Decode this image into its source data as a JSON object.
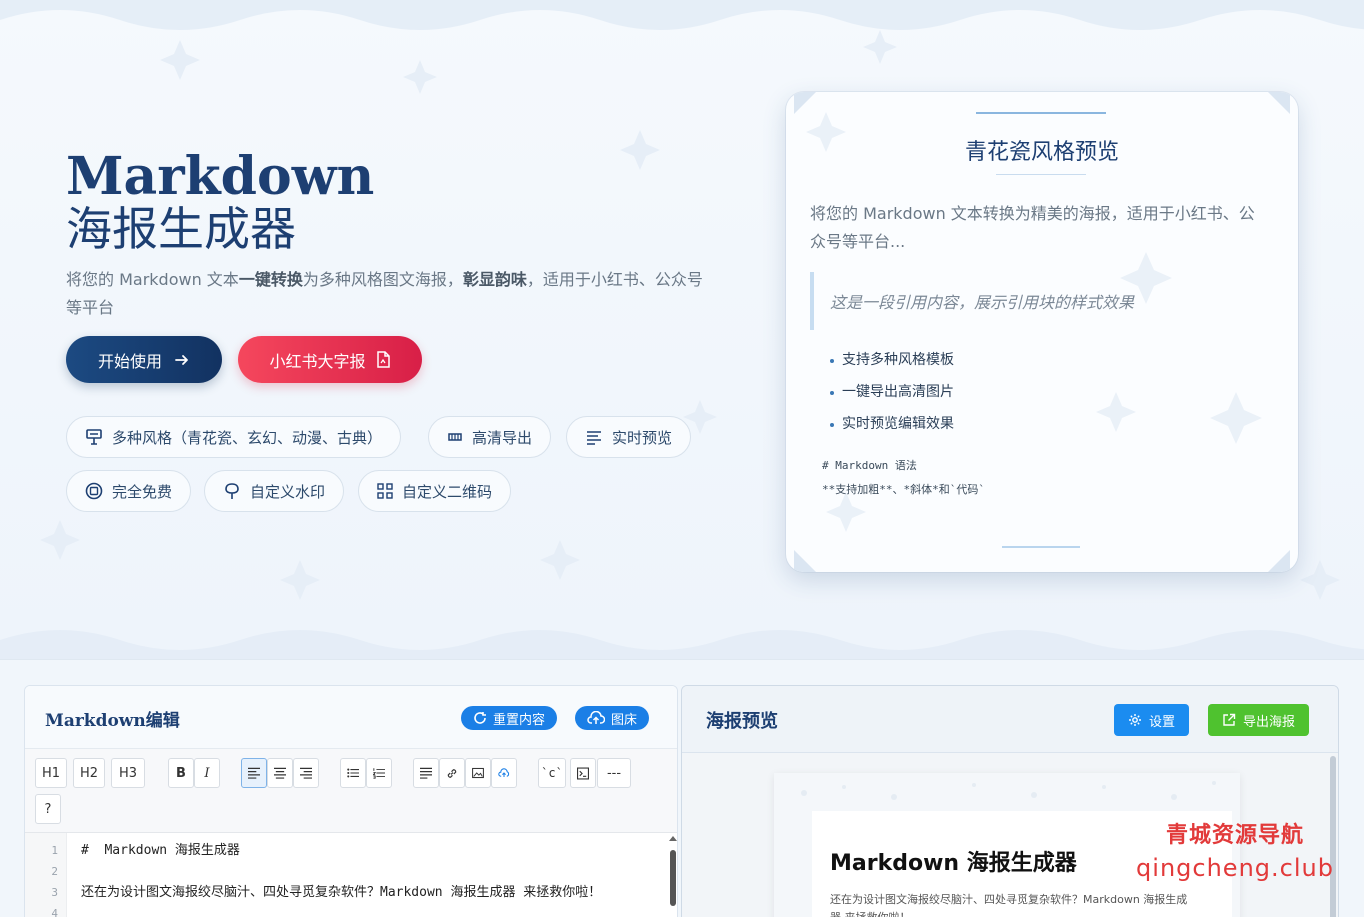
{
  "hero": {
    "title_line1": "Markdown",
    "title_line2": "海报生成器",
    "desc_part1": "将您的 Markdown 文本",
    "desc_bold1": "一键转换",
    "desc_part2": "为多种风格图文海报，",
    "desc_bold2": "彰显韵味",
    "desc_part3": "，适用于小红书、公众号等平台",
    "btn_start": "开始使用",
    "btn_xhs": "小红书大字报",
    "features": [
      {
        "label": "多种风格（青花瓷、玄幻、动漫、古典）",
        "icon": "palette-icon"
      },
      {
        "label": "高清导出",
        "icon": "hd-icon"
      },
      {
        "label": "实时预览",
        "icon": "lines-icon"
      },
      {
        "label": "完全免费",
        "icon": "free-icon"
      },
      {
        "label": "自定义水印",
        "icon": "stamp-icon"
      },
      {
        "label": "自定义二维码",
        "icon": "qrcode-icon"
      }
    ]
  },
  "preview_card": {
    "title": "青花瓷风格预览",
    "desc": "将您的 Markdown 文本转换为精美的海报，适用于小红书、公众号等平台...",
    "quote": "这是一段引用内容，展示引用块的样式效果",
    "list": [
      "支持多种风格模板",
      "一键导出高清图片",
      "实时预览编辑效果"
    ],
    "code_line1": "# Markdown 语法",
    "code_line2": "**支持加粗**、*斜体*和`代码`"
  },
  "editor": {
    "title": "Markdown编辑",
    "btn_reset": "重置内容",
    "btn_image_host": "图床",
    "toolbar": [
      "H1",
      "H2",
      "H3",
      "B",
      "I",
      "≡",
      "≡",
      "≡",
      "☰",
      "☰",
      "≡",
      "🔗",
      "▣",
      "☁",
      "`c`",
      "⊡",
      "---",
      "?"
    ],
    "line_numbers": [
      "1",
      "2",
      "3",
      "4"
    ],
    "lines": [
      "#  Markdown 海报生成器",
      "",
      "还在为设计图文海报绞尽脑汁、四处寻觅复杂软件？Markdown 海报生成器 来拯救你啦！",
      ""
    ]
  },
  "preview_panel": {
    "title": "海报预览",
    "btn_settings": "设置",
    "btn_export": "导出海报",
    "poster_title": "Markdown 海报生成器",
    "poster_text": "还在为设计图文海报绞尽脑汁、四处寻觅复杂软件？Markdown 海报生成器 来拯救你啦！"
  },
  "watermark": {
    "line1": "青城资源导航",
    "line2": "qingcheng.club"
  },
  "colors": {
    "brand_blue": "#1d3f72",
    "accent_blue": "#1b7fe6",
    "red": "#e0294e",
    "green": "#4fc22f"
  }
}
